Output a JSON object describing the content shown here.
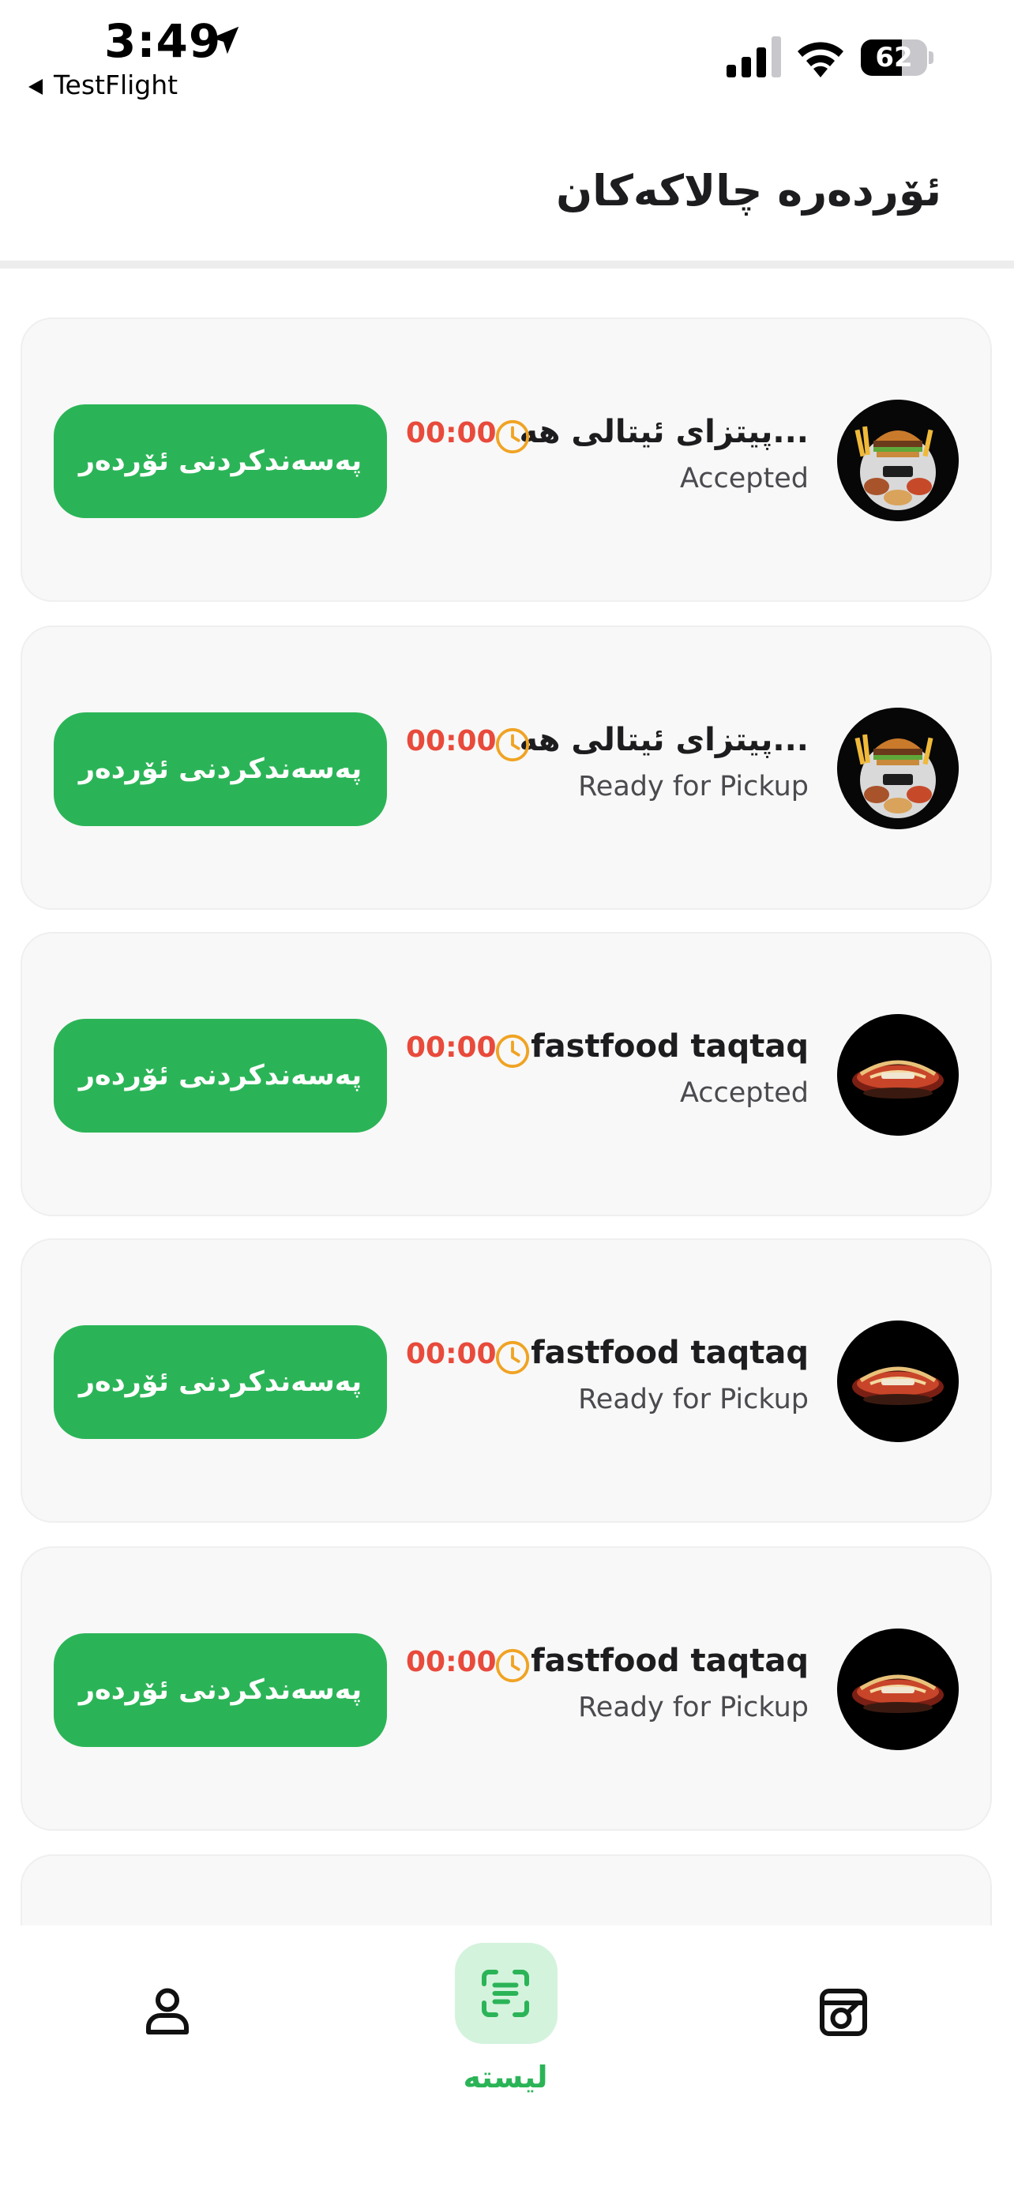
{
  "status_bar": {
    "time": "3:49",
    "back_app": "TestFlight",
    "battery_percent": "62",
    "battery_level": 0.62
  },
  "header": {
    "title": "ئۆردەرە چالاکەکان"
  },
  "orders": [
    {
      "restaurant": "پیتزای ئیتالی هە...",
      "status": "Accepted",
      "timer": "00:00",
      "action_label": "پەسەندکردنی ئۆردەر",
      "logo": "burger-combo-logo"
    },
    {
      "restaurant": "پیتزای ئیتالی هە...",
      "status": "Ready for Pickup",
      "timer": "00:00",
      "action_label": "پەسەندکردنی ئۆردەر",
      "logo": "burger-combo-logo"
    },
    {
      "restaurant": "fastfood taqtaq",
      "status": "Accepted",
      "timer": "00:00",
      "action_label": "پەسەندکردنی ئۆردەر",
      "logo": "fastfood-platter-logo"
    },
    {
      "restaurant": "fastfood taqtaq",
      "status": "Ready for Pickup",
      "timer": "00:00",
      "action_label": "پەسەندکردنی ئۆردەر",
      "logo": "fastfood-platter-logo"
    },
    {
      "restaurant": "fastfood taqtaq",
      "status": "Ready for Pickup",
      "timer": "00:00",
      "action_label": "پەسەندکردنی ئۆردەر",
      "logo": "fastfood-platter-logo"
    }
  ],
  "bottom_nav": {
    "active_label": "لیستە",
    "items": [
      "profile-icon",
      "list-scan-icon",
      "history-icon"
    ]
  },
  "colors": {
    "accent": "#2bb457",
    "timer": "#e84a3b",
    "clock": "#f0a323",
    "card_bg": "#f8f8f8"
  }
}
